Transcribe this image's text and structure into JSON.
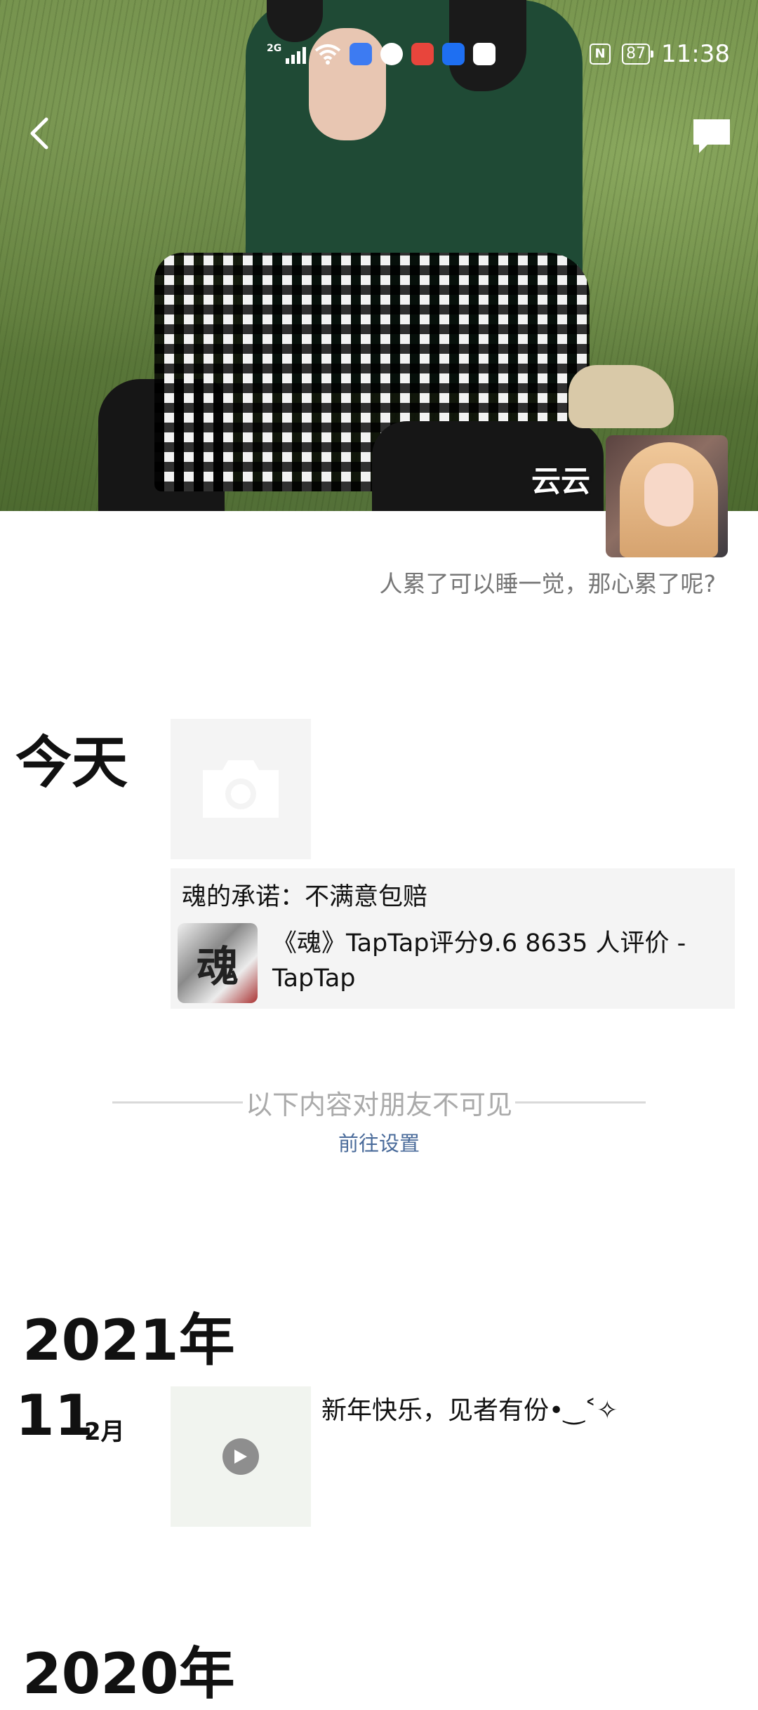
{
  "status_bar": {
    "network": "2G",
    "battery": "87",
    "time": "11:38",
    "nfc": "N"
  },
  "profile": {
    "name": "云云",
    "signature": "人累了可以睡一觉，那心累了呢?"
  },
  "feed": {
    "today_label": "今天",
    "link_post": {
      "title": "魂的承诺：不满意包赔",
      "thumb_char": "魂",
      "link_text": "《魂》TapTap评分9.6 8635 人评价 - TapTap"
    },
    "hidden_notice": "以下内容对朋友不可见",
    "goto_settings": "前往设置",
    "year_2021": "2021年",
    "post_2021": {
      "day": "11",
      "month": "2月",
      "text": "新年快乐，见者有份•‿˂✧"
    },
    "year_2020": "2020年"
  },
  "colors": {
    "link_blue": "#4a6b9a",
    "card_bg": "#f4f4f4",
    "divider": "#d9d9d9"
  }
}
